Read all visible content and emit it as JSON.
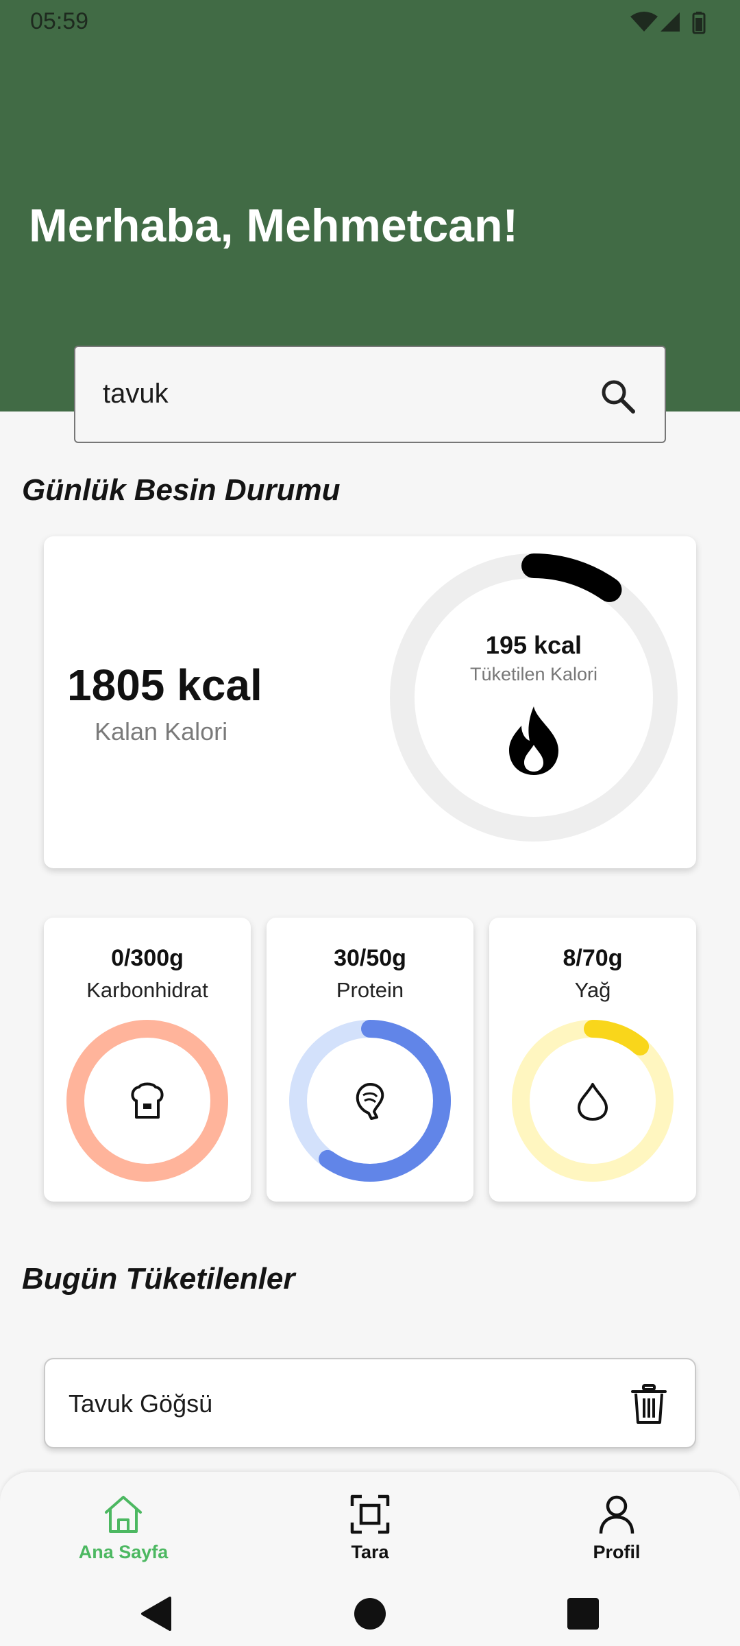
{
  "status_bar": {
    "time": "05:59"
  },
  "header": {
    "greeting": "Merhaba, Mehmetcan!"
  },
  "search": {
    "value": "tavuk"
  },
  "sections": {
    "daily_status": "Günlük Besin Durumu",
    "consumed_today": "Bugün Tüketilenler"
  },
  "calories": {
    "remaining_value": "1805 kcal",
    "remaining_label": "Kalan Kalori",
    "consumed_value": "195 kcal",
    "consumed_label": "Tüketilen Kalori",
    "consumed_fraction": 0.0975
  },
  "macros": [
    {
      "value": "0/300g",
      "label": "Karbonhidrat",
      "fraction": 0.0,
      "ring_color": "#ffb49b",
      "track_color": "#ffb49b",
      "icon": "bread-icon"
    },
    {
      "value": "30/50g",
      "label": "Protein",
      "fraction": 0.6,
      "ring_color": "#6185e8",
      "track_color": "#d3e1fb",
      "icon": "meat-icon"
    },
    {
      "value": "8/70g",
      "label": "Yağ",
      "fraction": 0.1143,
      "ring_color": "#f9d61b",
      "track_color": "#fff6c0",
      "icon": "drop-icon"
    }
  ],
  "consumed_items": [
    {
      "name": "Tavuk Göğsü"
    }
  ],
  "bottom_nav": [
    {
      "label": "Ana Sayfa",
      "icon": "home-icon",
      "active": true
    },
    {
      "label": "Tara",
      "icon": "scan-icon",
      "active": false
    },
    {
      "label": "Profil",
      "icon": "profile-icon",
      "active": false
    }
  ],
  "colors": {
    "header": "#416b45",
    "accent_green": "#4cb861"
  }
}
